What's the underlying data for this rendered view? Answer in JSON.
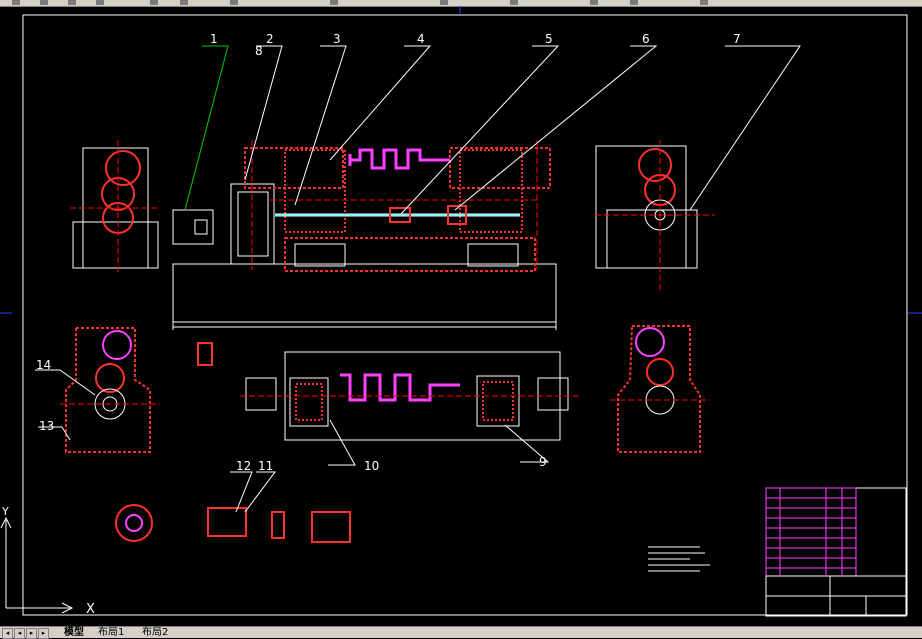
{
  "balloons": [
    "1",
    "2",
    "3",
    "4",
    "5",
    "6",
    "7",
    "8",
    "9",
    "10",
    "11",
    "12",
    "13",
    "14"
  ],
  "axis_x": "X",
  "axis_y": "Y",
  "tabs": [
    {
      "label": "模型"
    },
    {
      "label": "布局1"
    },
    {
      "label": "布局2"
    }
  ],
  "colors": {
    "background": "#000000",
    "outline": "#ffffff",
    "part_red": "#ff3030",
    "part_magenta": "#ff40ff",
    "leader": "#ffffff",
    "leader_green": "#00cc00",
    "center_red": "#ff0000",
    "border_blue": "#2d3cff"
  }
}
